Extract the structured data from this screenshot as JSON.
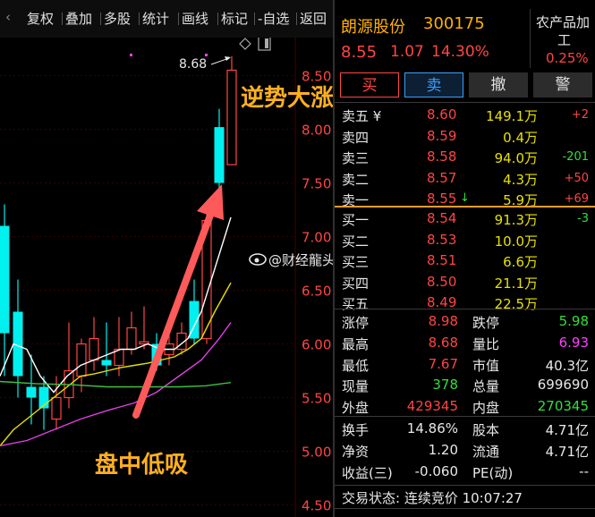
{
  "toolbar": {
    "items": [
      "复权",
      "叠加",
      "多股",
      "统计",
      "画线",
      "标记",
      "-自选",
      "返回"
    ]
  },
  "chart": {
    "price_labels": [
      "8.50",
      "8.00",
      "7.50",
      "7.00",
      "6.50",
      "6.00",
      "5.50",
      "5.00",
      "4.50"
    ],
    "high_marker": "8.68",
    "annotation_top": "逆势大涨",
    "annotation_bottom": "盘中低吸",
    "watermark": "@财经龍头"
  },
  "stock": {
    "name": "朗源股份",
    "code": "300175",
    "price": "8.55",
    "change": "1.07",
    "change_pct": "14.30%",
    "sector_line1": "农产品加",
    "sector_line2": "工",
    "sector_pct": "0.25%"
  },
  "buttons": [
    "买",
    "卖",
    "撤",
    "警"
  ],
  "sell_orders": [
    {
      "label": "卖五 ¥",
      "price": "8.60",
      "vol": "149.1万",
      "chg": "+2"
    },
    {
      "label": "卖四",
      "price": "8.59",
      "vol": "0.4万",
      "chg": ""
    },
    {
      "label": "卖三",
      "price": "8.58",
      "vol": "94.0万",
      "chg": "-201"
    },
    {
      "label": "卖二",
      "price": "8.57",
      "vol": "4.3万",
      "chg": "+50"
    },
    {
      "label": "卖一",
      "price": "8.55",
      "vol": "5.9万",
      "chg": "+69"
    }
  ],
  "buy_orders": [
    {
      "label": "买一",
      "price": "8.54",
      "vol": "91.3万",
      "chg": "-3"
    },
    {
      "label": "买二",
      "price": "8.53",
      "vol": "10.0万",
      "chg": ""
    },
    {
      "label": "买三",
      "price": "8.51",
      "vol": "6.6万",
      "chg": ""
    },
    {
      "label": "买四",
      "price": "8.50",
      "vol": "21.1万",
      "chg": ""
    },
    {
      "label": "买五",
      "price": "8.49",
      "vol": "22.5万",
      "chg": ""
    }
  ],
  "stats1": [
    {
      "l1": "涨停",
      "v1": "8.98",
      "l2": "跌停",
      "v2": "5.98"
    },
    {
      "l1": "最高",
      "v1": "8.68",
      "l2": "量比",
      "v2": "6.93"
    },
    {
      "l1": "最低",
      "v1": "7.67",
      "l2": "市值",
      "v2": "40.3亿"
    },
    {
      "l1": "现量",
      "v1": "378",
      "l2": "总量",
      "v2": "699690"
    },
    {
      "l1": "外盘",
      "v1": "429345",
      "l2": "内盘",
      "v2": "270345"
    }
  ],
  "stats2": [
    {
      "l1": "换手",
      "v1": "14.86%",
      "l2": "股本",
      "v2": "4.71亿"
    },
    {
      "l1": "净资",
      "v1": "1.20",
      "l2": "流通",
      "v2": "4.71亿"
    },
    {
      "l1": "收益(三)",
      "v1": "-0.060",
      "l2": "PE(动)",
      "v2": "--"
    }
  ],
  "trade_status": "交易状态: 连续竞价 10:07:27",
  "colors": {
    "red": "#ff4545",
    "green": "#31e039",
    "yellow": "#e7e000",
    "cyan": "#00f0f0",
    "magenta": "#ff40ff",
    "accent": "#ff6b6b"
  }
}
